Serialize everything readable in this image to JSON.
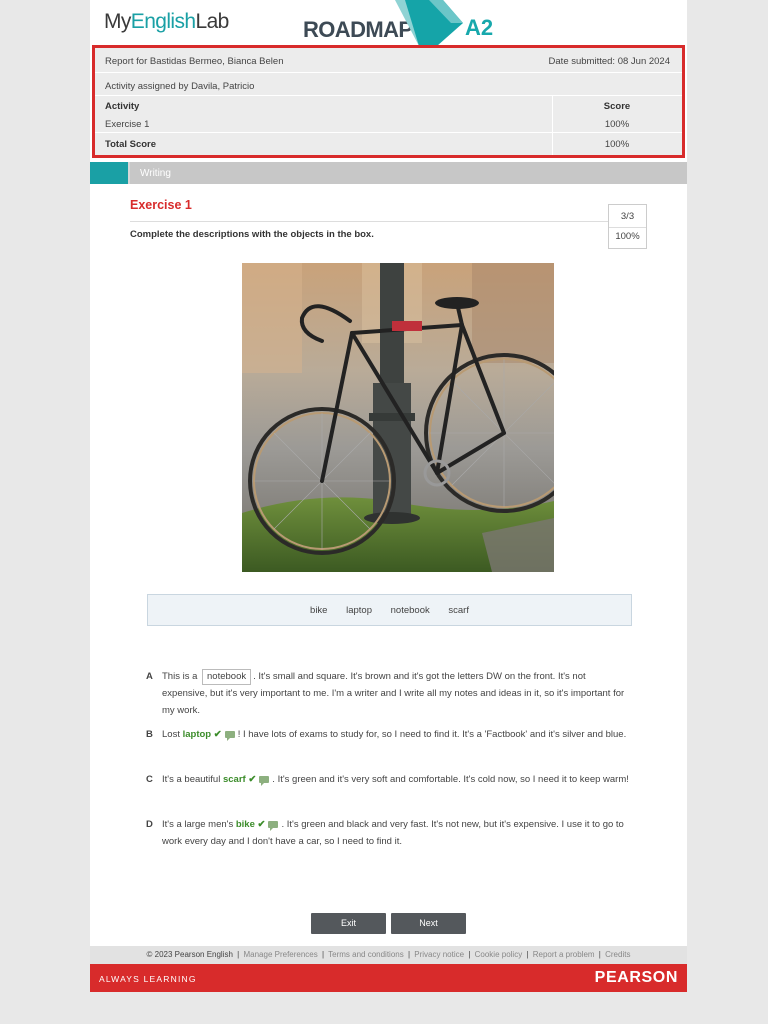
{
  "header": {
    "brand_my": "My",
    "brand_english": "English",
    "brand_lab": "Lab",
    "course_name": "ROADMAP",
    "course_tm": "™",
    "course_level": "A2"
  },
  "report": {
    "report_for": "Report for Bastidas Bermeo, Bianca Belen",
    "date_submitted": "Date submitted: 08 Jun 2024",
    "assigned_by": "Activity assigned by Davila, Patricio",
    "col_activity": "Activity",
    "col_score": "Score",
    "row_activity": "Exercise 1",
    "row_score": "100%",
    "total_label": "Total Score",
    "total_score": "100%"
  },
  "tabs": {
    "writing": "Writing"
  },
  "exercise": {
    "title": "Exercise 1",
    "score_fraction": "3/3",
    "score_percent": "100%",
    "instruction": "Complete the descriptions with the objects in the box.",
    "word_box": [
      "bike",
      "laptop",
      "notebook",
      "scarf"
    ]
  },
  "questions": {
    "a": {
      "letter": "A",
      "pre": "This is a",
      "gap": "notebook",
      "post": ". It's small and square. It's brown and it's got the letters DW on the front. It's not expensive, but it's very important to me. I'm a writer and I write all my notes and ideas in it, so it's important for my work."
    },
    "b": {
      "letter": "B",
      "pre": "Lost",
      "answer": "laptop",
      "post": "! I have lots of exams to study for, so I need to find it. It's a 'Factbook' and it's silver and blue."
    },
    "c": {
      "letter": "C",
      "pre": "It's a beautiful",
      "answer": "scarf",
      "post": ". It's green and it's very soft and comfortable. It's cold now, so I need it to keep warm!"
    },
    "d": {
      "letter": "D",
      "pre": "It's a large men's",
      "answer": "bike",
      "post": ". It's green and black and very fast. It's not new, but it's expensive. I use it to go to work every day and I don't have a car, so I need to find it."
    },
    "tick": "✔"
  },
  "buttons": {
    "exit": "Exit",
    "next": "Next"
  },
  "footer": {
    "copyright": "© 2023 Pearson English",
    "divider": "|",
    "links": [
      "Manage Preferences",
      "Terms and conditions",
      "Privacy notice",
      "Cookie policy",
      "Report a problem",
      "Credits"
    ],
    "tagline": "ALWAYS LEARNING",
    "brand": "PEARSON"
  },
  "colors": {
    "accent_teal": "#1aa0a5",
    "alert_red": "#d82b2b",
    "correct_green": "#3b8c2a",
    "button_gray": "#54585c"
  }
}
